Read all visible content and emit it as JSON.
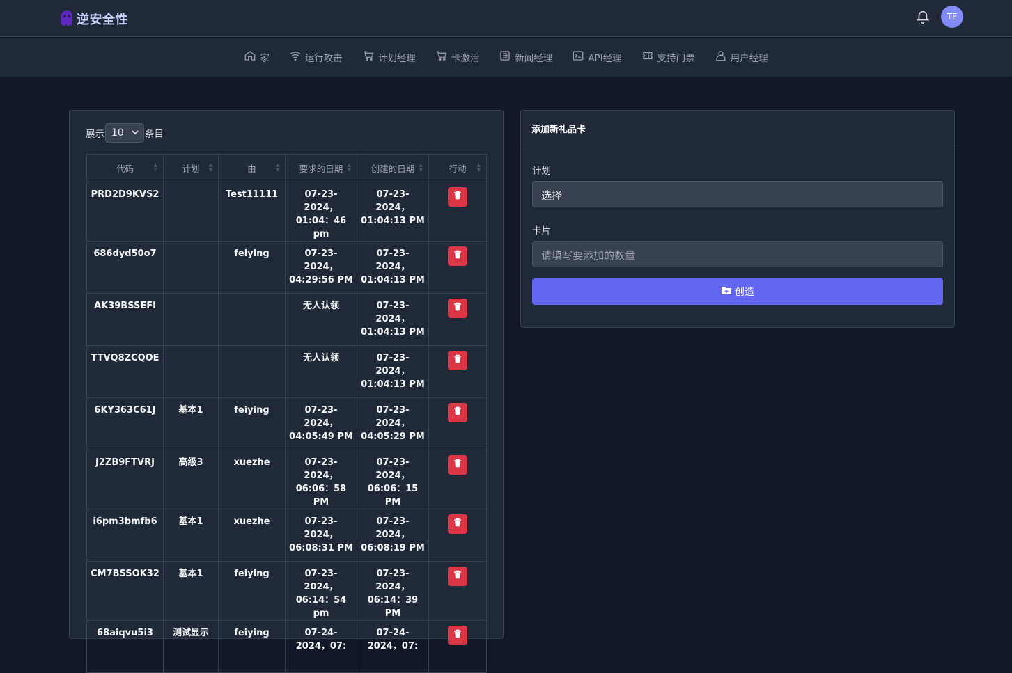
{
  "brand": {
    "name": "逆安全性"
  },
  "user": {
    "initials": "TE"
  },
  "nav": [
    {
      "label": "家",
      "icon": "home-icon"
    },
    {
      "label": "运行攻击",
      "icon": "wifi-icon"
    },
    {
      "label": "计划经理",
      "icon": "cart-icon"
    },
    {
      "label": "卡激活",
      "icon": "cart-icon"
    },
    {
      "label": "新闻经理",
      "icon": "newspaper-icon"
    },
    {
      "label": "API经理",
      "icon": "terminal-icon"
    },
    {
      "label": "支持门票",
      "icon": "ticket-icon"
    },
    {
      "label": "用户经理",
      "icon": "users-icon"
    }
  ],
  "table_section": {
    "show_label": "展示",
    "entries_value": "10",
    "entries_label": "条目",
    "columns": [
      "代码",
      "计划",
      "由",
      "要求的日期",
      "创建的日期",
      "行动"
    ],
    "rows": [
      {
        "code": "PRD2D9KVS2",
        "plan": "",
        "by": "Test11111",
        "claimed": "07-23-2024，01:04：46 pm",
        "created": "07-23-2024，01:04:13 PM"
      },
      {
        "code": "686dyd50o7",
        "plan": "",
        "by": "feiying",
        "claimed": "07-23-2024，04:29:56 PM",
        "created": "07-23-2024，01:04:13 PM"
      },
      {
        "code": "AK39BSSEFI",
        "plan": "",
        "by": "",
        "claimed": "无人认领",
        "created": "07-23-2024，01:04:13 PM"
      },
      {
        "code": "TTVQ8ZCQOE",
        "plan": "",
        "by": "",
        "claimed": "无人认领",
        "created": "07-23-2024，01:04:13 PM"
      },
      {
        "code": "6KY363C61J",
        "plan": "基本1",
        "by": "feiying",
        "claimed": "07-23-2024，04:05:49 PM",
        "created": "07-23-2024，04:05:29 PM"
      },
      {
        "code": "J2ZB9FTVRJ",
        "plan": "高级3",
        "by": "xuezhe",
        "claimed": "07-23-2024，06:06：58 PM",
        "created": "07-23-2024，06:06：15 PM"
      },
      {
        "code": "i6pm3bmfb6",
        "plan": "基本1",
        "by": "xuezhe",
        "claimed": "07-23-2024，06:08:31 PM",
        "created": "07-23-2024，06:08:19 PM"
      },
      {
        "code": "CM7BSSOK32",
        "plan": "基本1",
        "by": "feiying",
        "claimed": "07-23-2024，06:14：54 pm",
        "created": "07-23-2024，06:14：39 PM"
      },
      {
        "code": "68aiqvu5i3",
        "plan": "测试显示",
        "by": "feiying",
        "claimed": "07-24-2024，07:",
        "created": "07-24-2024，07:"
      }
    ]
  },
  "gift_card_form": {
    "title": "添加新礼品卡",
    "plan_label": "计划",
    "plan_value": "选择",
    "cards_label": "卡片",
    "cards_placeholder": "请填写要添加的数量",
    "create_label": "创造"
  },
  "colors": {
    "background": "#111827",
    "panel": "#1f2937",
    "accent": "#6366f1",
    "danger": "#dc3545"
  }
}
